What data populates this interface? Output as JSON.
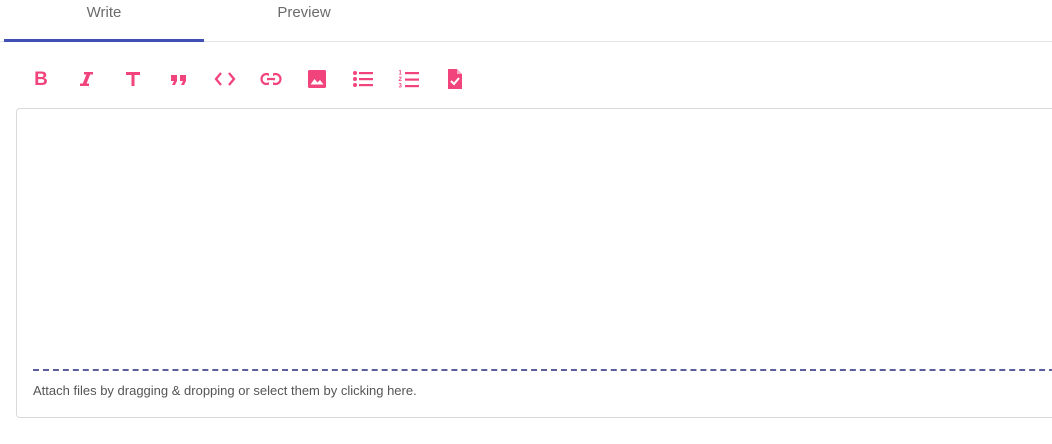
{
  "tabs": [
    {
      "label": "Write",
      "active": true
    },
    {
      "label": "Preview",
      "active": false
    }
  ],
  "toolbar": {
    "accent_color": "#f2447c",
    "buttons": [
      {
        "name": "bold",
        "glyph": "B"
      },
      {
        "name": "italic",
        "glyph": "I"
      },
      {
        "name": "heading",
        "glyph": "T"
      },
      {
        "name": "quote",
        "glyph": "❞"
      },
      {
        "name": "code",
        "glyph": "<>"
      },
      {
        "name": "link",
        "glyph": "link"
      },
      {
        "name": "image",
        "glyph": "image"
      },
      {
        "name": "bulleted-list",
        "glyph": "list"
      },
      {
        "name": "numbered-list",
        "glyph": "ordered-list"
      },
      {
        "name": "checklist",
        "glyph": "file-check"
      }
    ]
  },
  "editor": {
    "value": "",
    "attach_hint": "Attach files by dragging & dropping or select them by clicking here."
  },
  "colors": {
    "tab_indicator": "#3f51b5",
    "dropzone_border": "#5a5f9c"
  }
}
